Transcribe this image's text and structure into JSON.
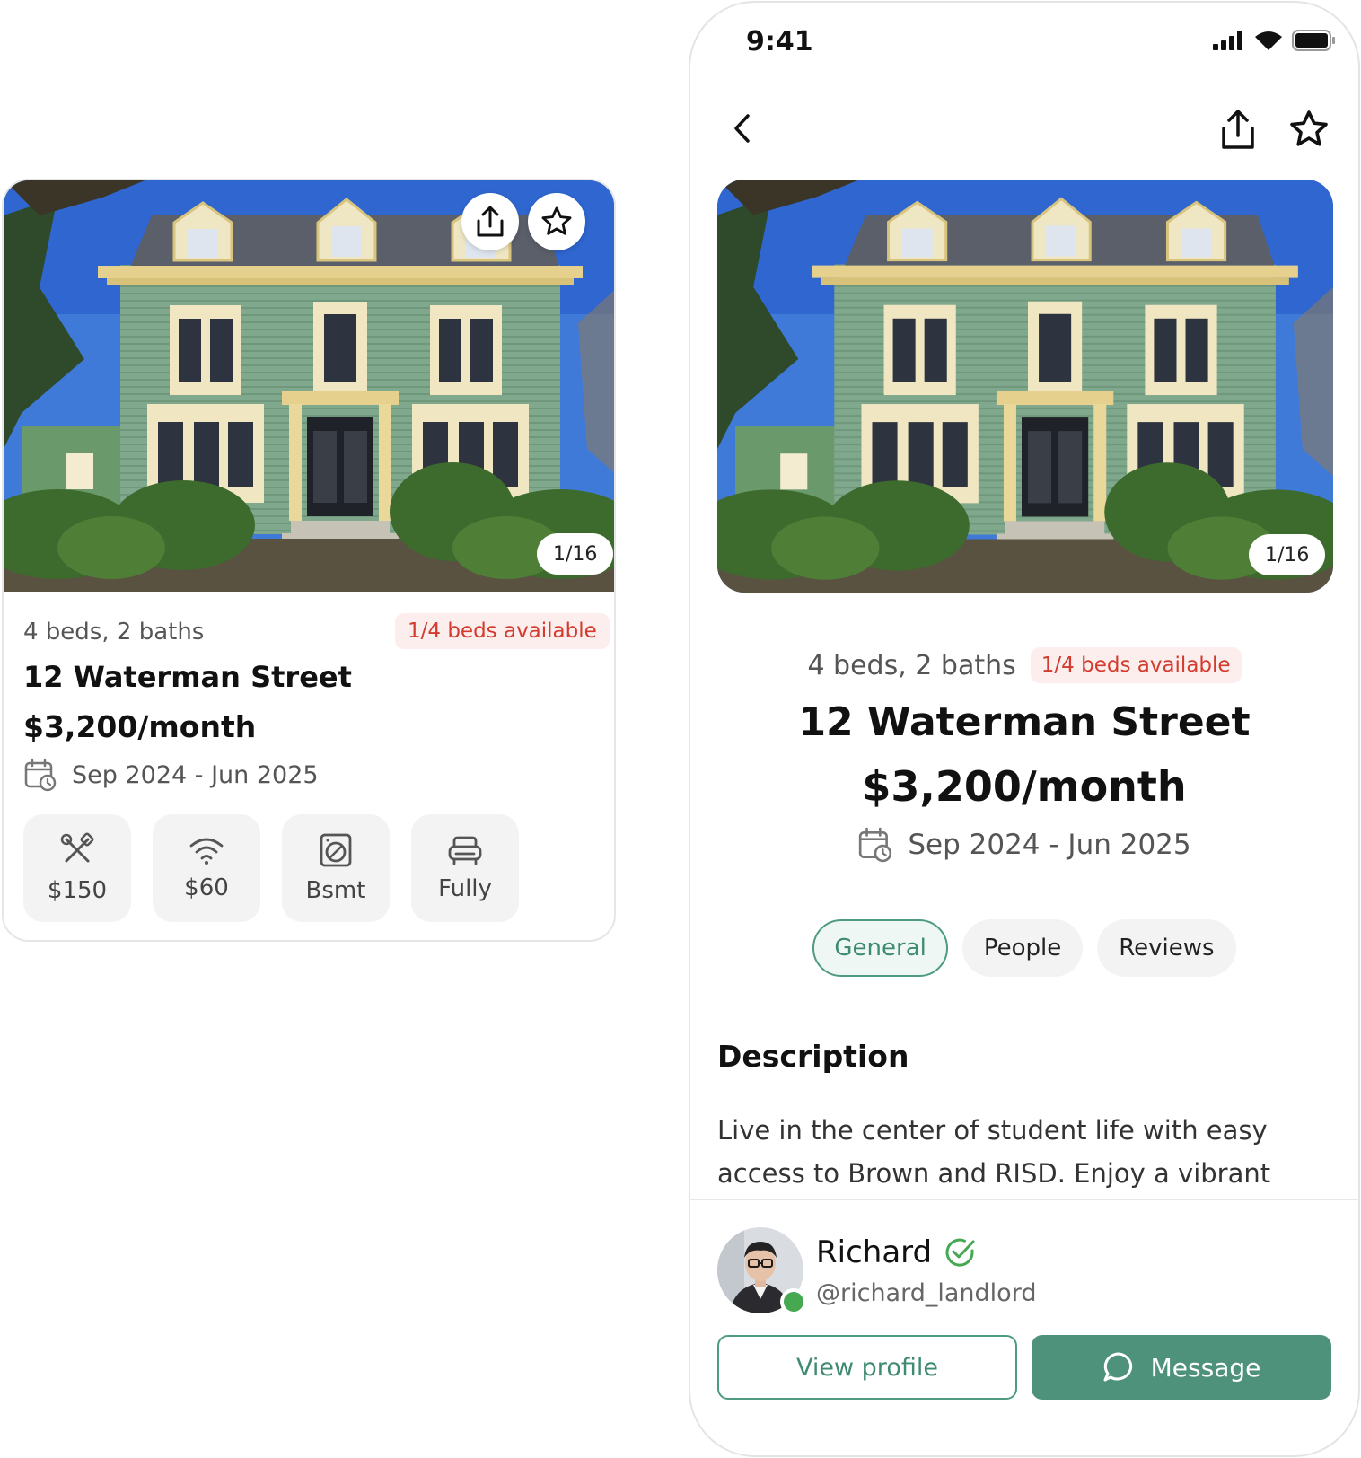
{
  "listing": {
    "beds_baths": "4 beds, 2 baths",
    "availability": "1/4 beds available",
    "address": "12 Waterman Street",
    "price": "$3,200/month",
    "dates": "Sep 2024 - Jun 2025",
    "photo_counter": "1/16"
  },
  "card": {
    "amenities": [
      {
        "icon": "tools-icon",
        "label": "$150"
      },
      {
        "icon": "wifi-icon",
        "label": "$60"
      },
      {
        "icon": "washer-icon",
        "label": "Bsmt"
      },
      {
        "icon": "sofa-icon",
        "label": "Fully"
      }
    ]
  },
  "phone": {
    "status_time": "9:41",
    "tabs": [
      "General",
      "People",
      "Reviews"
    ],
    "active_tab": "General",
    "description_heading": "Description",
    "description_text": "Live in the center of student life with easy access to Brown and RISD. Enjoy a vibrant",
    "landlord": {
      "name": "Richard",
      "handle": "@richard_landlord",
      "verified": true,
      "online": true
    },
    "buttons": {
      "view_profile": "View profile",
      "message": "Message"
    }
  },
  "colors": {
    "accent": "#4f927c",
    "badge_text": "#d23b2e",
    "badge_bg": "#fdeeee",
    "online": "#47a852"
  }
}
